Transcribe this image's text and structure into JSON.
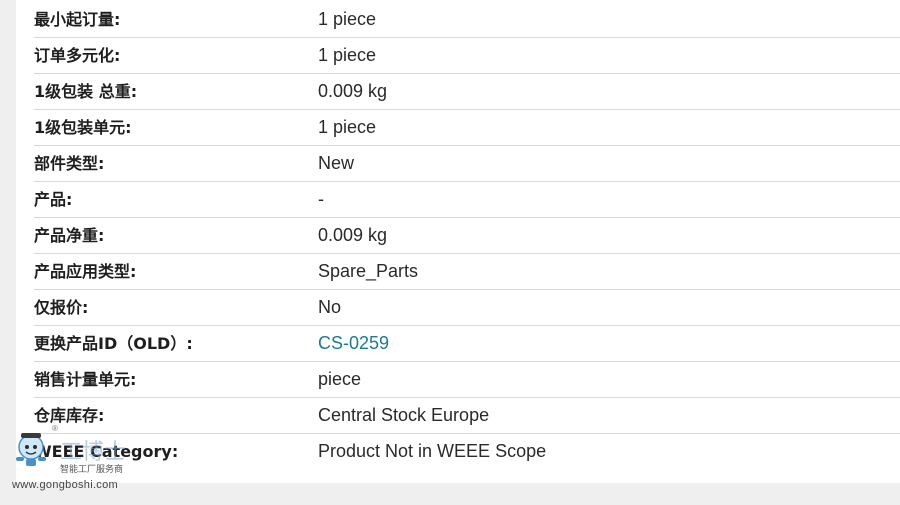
{
  "spec_table": {
    "rows": [
      {
        "label": "最小起订量:",
        "value": "1 piece"
      },
      {
        "label": "订单多元化:",
        "value": "1 piece"
      },
      {
        "label": "1级包装 总重:",
        "value": "0.009 kg"
      },
      {
        "label": "1级包装单元:",
        "value": "1 piece"
      },
      {
        "label": "部件类型:",
        "value": "New"
      },
      {
        "label": "产品:",
        "value": "-"
      },
      {
        "label": "产品净重:",
        "value": "0.009 kg"
      },
      {
        "label": "产品应用类型:",
        "value": "Spare_Parts"
      },
      {
        "label": "仅报价:",
        "value": "No"
      },
      {
        "label": "更换产品ID（OLD）:",
        "value": "CS-0259"
      },
      {
        "label": "销售计量单元:",
        "value": "piece"
      },
      {
        "label": "仓库库存:",
        "value": "Central Stock Europe"
      },
      {
        "label": "WEEE Category:",
        "value": "Product Not in WEEE Scope"
      }
    ]
  },
  "watermark": {
    "reg_mark": "®",
    "brand_text": "工博士",
    "subtitle": "智能工厂服务商",
    "url": "www.gongboshi.com"
  },
  "colors": {
    "link": "#1d7a93",
    "divider": "#d8d8d8",
    "background": "#efefef"
  }
}
